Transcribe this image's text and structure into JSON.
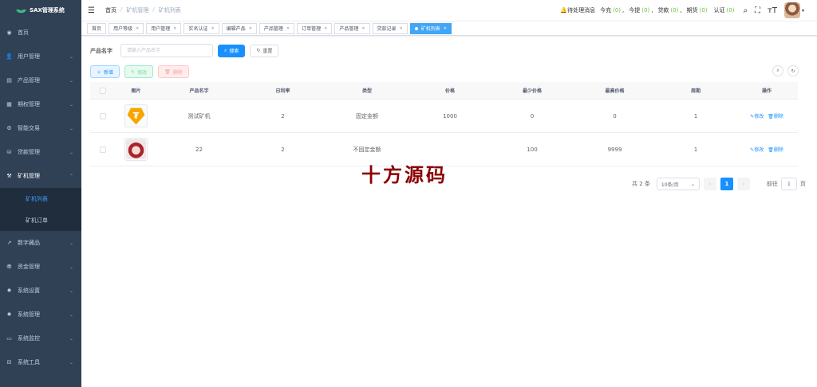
{
  "app": {
    "title": "SAX管理系统"
  },
  "sidebar": {
    "items": [
      {
        "label": "首页",
        "icon": "dashboard-icon",
        "glyph": "◉"
      },
      {
        "label": "用户管理",
        "icon": "user-icon",
        "glyph": "👤"
      },
      {
        "label": "产品管理",
        "icon": "document-icon",
        "glyph": "▤"
      },
      {
        "label": "期权管理",
        "icon": "chart-icon",
        "glyph": "▦"
      },
      {
        "label": "智能交易",
        "icon": "gear-icon",
        "glyph": "⚙"
      },
      {
        "label": "贷款管理",
        "icon": "loan-icon",
        "glyph": "⛁"
      },
      {
        "label": "矿机管理",
        "icon": "tool-icon",
        "glyph": "⚒"
      },
      {
        "label": "数字藏品",
        "icon": "trend-icon",
        "glyph": "↗"
      },
      {
        "label": "资金管理",
        "icon": "fund-icon",
        "glyph": "⛃"
      },
      {
        "label": "系统设置",
        "icon": "settings-icon",
        "glyph": "✹"
      },
      {
        "label": "系统管理",
        "icon": "system-icon",
        "glyph": "✹"
      },
      {
        "label": "系统监控",
        "icon": "monitor-icon",
        "glyph": "▭"
      },
      {
        "label": "系统工具",
        "icon": "toolbox-icon",
        "glyph": "⊟"
      }
    ],
    "submenu": [
      {
        "label": "矿机列表"
      },
      {
        "label": "矿机订单"
      }
    ]
  },
  "navbar": {
    "breadcrumb": [
      "首页",
      "矿机管理",
      "矿机列表"
    ],
    "bc_sep": "/",
    "pending_label": "待处理消息",
    "today_label": "今充",
    "today_count": "(0)",
    "withdraw_label": "今提",
    "withdraw_count": "(0)",
    "loan_label": "贷款",
    "loan_count": "(0)",
    "period_label": "期货",
    "period_count": "(0)",
    "auth_label": "认证",
    "auth_count": "(0)",
    "comma": ","
  },
  "tags": [
    {
      "label": "首页"
    },
    {
      "label": "用户等级"
    },
    {
      "label": "用户管理"
    },
    {
      "label": "实名认证"
    },
    {
      "label": "编辑产品"
    },
    {
      "label": "产品管理"
    },
    {
      "label": "订单管理"
    },
    {
      "label": "产品管理"
    },
    {
      "label": "贷款记录"
    },
    {
      "label": "矿机列表"
    }
  ],
  "search": {
    "label": "产品名字",
    "placeholder": "请输入产品名字",
    "search_btn": "搜索",
    "reset_btn": "重置"
  },
  "toolbar": {
    "add": "新增",
    "edit": "修改",
    "delete": "删除"
  },
  "table": {
    "columns": [
      "图片",
      "产品名字",
      "日利率",
      "类型",
      "价格",
      "最少价格",
      "最高价格",
      "周期",
      "操作"
    ],
    "rows": [
      {
        "image": "tether-icon",
        "name": "测试矿机",
        "rate": "2",
        "type": "固定金额",
        "price": "1000",
        "min": "0",
        "max": "0",
        "cycle": "1"
      },
      {
        "image": "anime-avatar",
        "name": "22",
        "rate": "2",
        "type": "不固定金额",
        "price": "",
        "min": "100",
        "max": "9999",
        "cycle": "1"
      }
    ],
    "op_edit": "修改",
    "op_delete": "删除"
  },
  "pagination": {
    "total": "共 2 条",
    "page_size": "10条/页",
    "current": "1",
    "goto_label": "前往",
    "goto_value": "1",
    "page_suffix": "页"
  },
  "watermark": "十方源码",
  "colors": {
    "sidebar_bg": "#304156",
    "primary": "#1890ff",
    "active_tag": "#42a5f5",
    "success": "#67c23a"
  }
}
